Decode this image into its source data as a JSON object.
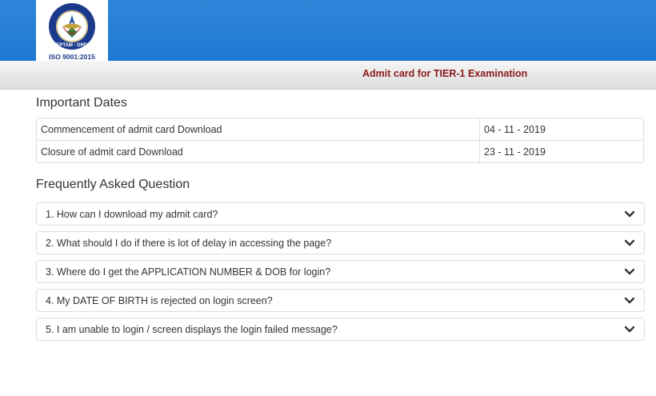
{
  "header": {
    "logo_text": "CEPTAM - DRDO",
    "logo_cert": "ISO 9001:2015",
    "brand_color": "#1f78d3"
  },
  "subbar": {
    "title": "Admit card for TIER-1 Examination",
    "title_color": "#8b1a1a"
  },
  "important_dates": {
    "heading": "Important Dates",
    "rows": [
      {
        "label": "Commencement of admit card Download",
        "value": "04 - 11 - 2019"
      },
      {
        "label": "Closure of admit card Download",
        "value": "23 - 11 - 2019"
      }
    ]
  },
  "faq": {
    "heading": "Frequently Asked Question",
    "items": [
      {
        "text": "1. How can I download my admit card?",
        "icon": "chevron-down-icon"
      },
      {
        "text": "2. What should I do if there is lot of delay in accessing the page?",
        "icon": "chevron-down-icon"
      },
      {
        "text": "3. Where do I get the APPLICATION NUMBER & DOB for login?",
        "icon": "chevron-down-icon"
      },
      {
        "text": "4. My DATE OF BIRTH is rejected on login screen?",
        "icon": "chevron-down-icon"
      },
      {
        "text": "5. I am unable to login / screen displays the login failed message?",
        "icon": "chevron-down-icon"
      }
    ]
  }
}
